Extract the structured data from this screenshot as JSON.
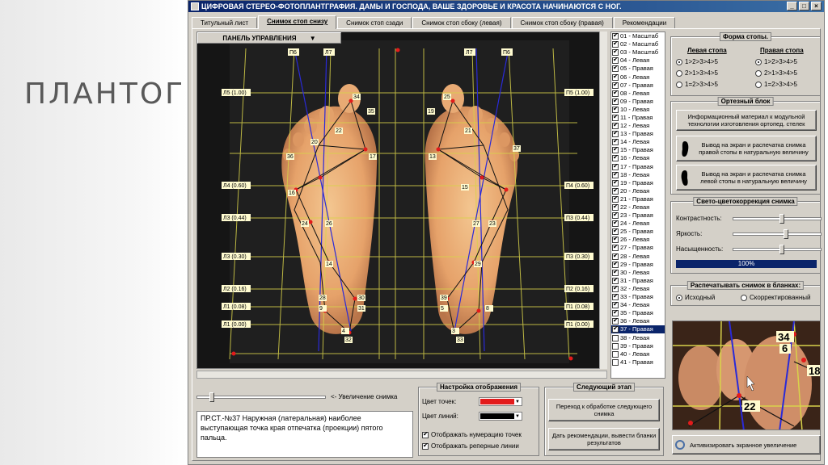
{
  "slide": {
    "title": "ПЛАНТОГРАФИЯ"
  },
  "window": {
    "title": "ЦИФРОВАЯ СТЕРЕО-ФОТОПЛАНТГРАФИЯ.     ДАМЫ И ГОСПОДА, ВАШЕ ЗДОРОВЬЕ И КРАСОТА НАЧИНАЮТСЯ С НОГ.",
    "buttons": [
      "_",
      "□",
      "×"
    ]
  },
  "tabs": [
    "Титульный лист",
    "Снимок стоп снизу",
    "Снимок стоп сзади",
    "Снимок стоп сбоку (левая)",
    "Снимок стоп сбоку (правая)",
    "Рекомендации"
  ],
  "active_tab": 1,
  "control_panel": {
    "label": "ПАНЕЛЬ УПРАВЛЕНИЯ",
    "arrow": "▼"
  },
  "photo": {
    "level_labels": [
      "Л5 (1.00)",
      "Л4 (0.60)",
      "Л3 (0.44)",
      "Л3 (0.30)",
      "Л2 (0.16)",
      "Л1 (0.08)",
      "Л1 (0.00)"
    ],
    "right_level_labels": [
      "П5 (1.00)",
      "П4 (0.60)",
      "П3 (0.44)",
      "П3 (0.30)",
      "П2 (0.16)",
      "П1 (0.08)",
      "П1 (0.00)"
    ],
    "top_labels": [
      "П6",
      "Л7",
      "Л7",
      "П6"
    ],
    "left_points": [
      "34",
      "35",
      "22",
      "20",
      "36",
      "17",
      "16",
      "24",
      "26",
      "14",
      "28",
      "30",
      "9",
      "31",
      "4",
      "32"
    ],
    "right_points": [
      "25",
      "19",
      "21",
      "13",
      "37",
      "27",
      "23",
      "15",
      "29",
      "39",
      "8",
      "5",
      "33",
      "3"
    ]
  },
  "list": {
    "items": [
      "01 - Масштаб",
      "02 - Масштаб",
      "03 - Масштаб",
      "04 - Левая",
      "05 - Правая",
      "06 - Левая",
      "07 - Правая",
      "08 - Левая",
      "09 - Правая",
      "10 - Левая",
      "11 - Правая",
      "12 - Левая",
      "13 - Правая",
      "14 - Левая",
      "15 - Правая",
      "16 - Левая",
      "17 - Правая",
      "18 - Левая",
      "19 - Правая",
      "20 - Левая",
      "21 - Правая",
      "22 - Левая",
      "23 - Правая",
      "24 - Левая",
      "25 - Правая",
      "26 - Левая",
      "27 - Правая",
      "28 - Левая",
      "29 - Правая",
      "30 - Левая",
      "31 - Правая",
      "32 - Левая",
      "33 - Правая",
      "34 - Левая",
      "35 - Правая",
      "36 - Левая",
      "37 - Правая",
      "38 - Левая",
      "39 - Правая",
      "40 - Левая",
      "41 - Правая"
    ],
    "selected_index": 36,
    "checked_until": 36
  },
  "foot_shape": {
    "title": "Форма стопы.",
    "left_head": "Левая стопа",
    "right_head": "Правая стопа",
    "left_options": [
      "1>2>3>4>5",
      "2>1>3>4>5",
      "1=2>3>4>5"
    ],
    "right_options": [
      "1>2>3>4>5",
      "2>1>3>4>5",
      "1=2>3>4>5"
    ],
    "left_selected": 0,
    "right_selected": 0
  },
  "ortho": {
    "title": "Ортезный блок",
    "info_button": "Информационный материал к модульной технологии изготовления ортопед. стелек",
    "right_print": "Вывод на экран и распечатка снимка правой стопы в натуральную величину",
    "left_print": "Вывод на экран и распечатка снимка левой стопы в натуральную величину"
  },
  "color_correction": {
    "title": "Свето-цветокоррекция снимка",
    "sliders": [
      {
        "label": "Контрастность:",
        "value": 0.55
      },
      {
        "label": "Яркость:",
        "value": 0.6
      },
      {
        "label": "Насыщенность:",
        "value": 0.55
      }
    ],
    "progress_label": "100%",
    "progress_value": 1.0
  },
  "print_group": {
    "title": "Распечатывать снимок в бланках:",
    "options": [
      "Исходный",
      "Скорректированный"
    ],
    "selected": 0
  },
  "preview": {
    "points": [
      "34",
      "6",
      "18",
      "22"
    ]
  },
  "zoom": {
    "label": "<- Увеличение снимка",
    "value": 0.1
  },
  "description": {
    "text": "ПР.СТ.-№37 Наружная (латеральная) наиболее выступающая точка края отпечатка (проекции) пятого пальца."
  },
  "display_settings": {
    "title": "Настройка отображения",
    "point_color_label": "Цвет точек:",
    "line_color_label": "Цвет линий:",
    "point_color": "#e31b1b",
    "line_color": "#000000",
    "show_numbers": "Отображать нумерацию точек",
    "show_ref_lines": "Отображать реперные линии"
  },
  "next_stage": {
    "title": "Следующий этап",
    "next_button": "Переход к обработке следующего снимка",
    "results_button": "Дать рекомендации, вывести бланки результатов"
  },
  "zoom_activate": {
    "label": "Активизировать экранное увеличение"
  }
}
